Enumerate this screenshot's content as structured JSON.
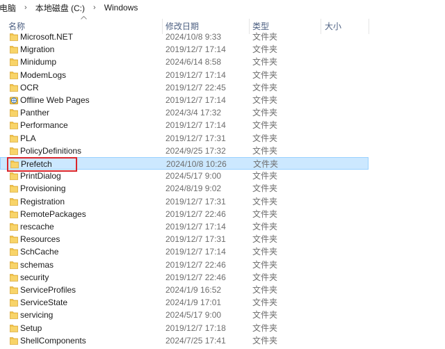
{
  "breadcrumb": {
    "items": [
      "电脑",
      "本地磁盘 (C:)",
      "Windows"
    ],
    "separator": "›"
  },
  "columns": {
    "name": "名称",
    "date": "修改日期",
    "type": "类型",
    "size": "大小"
  },
  "colors": {
    "folder": "#f3c54a",
    "selection_bg": "#cce8ff",
    "highlight_border": "#d9252b"
  },
  "files": [
    {
      "name": "Microsoft.NET",
      "date": "2024/10/8 9:33",
      "type": "文件夹",
      "icon": "folder-icon"
    },
    {
      "name": "Migration",
      "date": "2019/12/7 17:14",
      "type": "文件夹",
      "icon": "folder-icon"
    },
    {
      "name": "Minidump",
      "date": "2024/6/14 8:58",
      "type": "文件夹",
      "icon": "folder-icon"
    },
    {
      "name": "ModemLogs",
      "date": "2019/12/7 17:14",
      "type": "文件夹",
      "icon": "folder-icon"
    },
    {
      "name": "OCR",
      "date": "2019/12/7 22:45",
      "type": "文件夹",
      "icon": "folder-icon"
    },
    {
      "name": "Offline Web Pages",
      "date": "2019/12/7 17:14",
      "type": "文件夹",
      "icon": "offline-pages-icon"
    },
    {
      "name": "Panther",
      "date": "2024/3/4 17:32",
      "type": "文件夹",
      "icon": "folder-icon"
    },
    {
      "name": "Performance",
      "date": "2019/12/7 17:14",
      "type": "文件夹",
      "icon": "folder-icon"
    },
    {
      "name": "PLA",
      "date": "2019/12/7 17:31",
      "type": "文件夹",
      "icon": "folder-icon"
    },
    {
      "name": "PolicyDefinitions",
      "date": "2024/9/25 17:32",
      "type": "文件夹",
      "icon": "folder-icon"
    },
    {
      "name": "Prefetch",
      "date": "2024/10/8 10:26",
      "type": "文件夹",
      "icon": "folder-icon",
      "selected": true
    },
    {
      "name": "PrintDialog",
      "date": "2024/5/17 9:00",
      "type": "文件夹",
      "icon": "folder-icon"
    },
    {
      "name": "Provisioning",
      "date": "2024/8/19 9:02",
      "type": "文件夹",
      "icon": "folder-icon"
    },
    {
      "name": "Registration",
      "date": "2019/12/7 17:31",
      "type": "文件夹",
      "icon": "folder-icon"
    },
    {
      "name": "RemotePackages",
      "date": "2019/12/7 22:46",
      "type": "文件夹",
      "icon": "folder-icon"
    },
    {
      "name": "rescache",
      "date": "2019/12/7 17:14",
      "type": "文件夹",
      "icon": "folder-icon"
    },
    {
      "name": "Resources",
      "date": "2019/12/7 17:31",
      "type": "文件夹",
      "icon": "folder-icon"
    },
    {
      "name": "SchCache",
      "date": "2019/12/7 17:14",
      "type": "文件夹",
      "icon": "folder-icon"
    },
    {
      "name": "schemas",
      "date": "2019/12/7 22:46",
      "type": "文件夹",
      "icon": "folder-icon"
    },
    {
      "name": "security",
      "date": "2019/12/7 22:46",
      "type": "文件夹",
      "icon": "folder-icon"
    },
    {
      "name": "ServiceProfiles",
      "date": "2024/1/9 16:52",
      "type": "文件夹",
      "icon": "folder-icon"
    },
    {
      "name": "ServiceState",
      "date": "2024/1/9 17:01",
      "type": "文件夹",
      "icon": "folder-icon"
    },
    {
      "name": "servicing",
      "date": "2024/5/17 9:00",
      "type": "文件夹",
      "icon": "folder-icon"
    },
    {
      "name": "Setup",
      "date": "2019/12/7 17:18",
      "type": "文件夹",
      "icon": "folder-icon"
    },
    {
      "name": "ShellComponents",
      "date": "2024/7/25 17:41",
      "type": "文件夹",
      "icon": "folder-icon"
    }
  ]
}
